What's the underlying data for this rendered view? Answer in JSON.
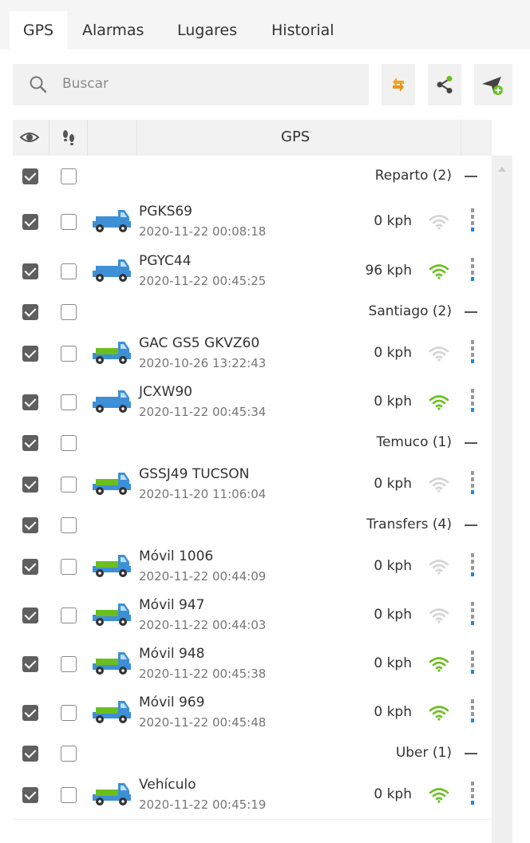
{
  "tabs": [
    {
      "label": "GPS",
      "active": true
    },
    {
      "label": "Alarmas",
      "active": false
    },
    {
      "label": "Lugares",
      "active": false
    },
    {
      "label": "Historial",
      "active": false
    }
  ],
  "search": {
    "placeholder": "Buscar",
    "icon": "search-icon"
  },
  "toolbar": [
    {
      "name": "refresh-button",
      "icon": "sync-icon",
      "color": "#f5a623"
    },
    {
      "name": "share-button",
      "icon": "share-icon",
      "color": "#6abf1e"
    },
    {
      "name": "add-device-button",
      "icon": "send-add-icon",
      "color": "#6abf1e"
    }
  ],
  "header": {
    "visibility_icon": "eye-icon",
    "follow_icon": "footprints-icon",
    "title": "GPS"
  },
  "colors": {
    "accent_green": "#6abf1e",
    "checkbox_dark": "#5f5f5f",
    "menu_blue": "#1e88e5",
    "truck_blue": "#3d8fd6"
  },
  "groups": [
    {
      "label": "Reparto (2)",
      "visible": true,
      "follow": false,
      "vehicles": [
        {
          "name": "PGKS69",
          "time": "2020-11-22 00:08:18",
          "speed": "0 kph",
          "online": false,
          "cargo": "blue",
          "visible": true,
          "follow": false
        },
        {
          "name": "PGYC44",
          "time": "2020-11-22 00:45:25",
          "speed": "96 kph",
          "online": true,
          "cargo": "blue",
          "visible": true,
          "follow": false
        }
      ]
    },
    {
      "label": "Santiago (2)",
      "visible": true,
      "follow": false,
      "vehicles": [
        {
          "name": "GAC GS5 GKVZ60",
          "time": "2020-10-26 13:22:43",
          "speed": "0 kph",
          "online": false,
          "cargo": "green",
          "visible": true,
          "follow": false
        },
        {
          "name": "JCXW90",
          "time": "2020-11-22 00:45:34",
          "speed": "0 kph",
          "online": true,
          "cargo": "blue",
          "visible": true,
          "follow": false
        }
      ]
    },
    {
      "label": "Temuco (1)",
      "visible": true,
      "follow": false,
      "vehicles": [
        {
          "name": "GSSJ49 TUCSON",
          "time": "2020-11-20 11:06:04",
          "speed": "0 kph",
          "online": false,
          "cargo": "green",
          "visible": true,
          "follow": false
        }
      ]
    },
    {
      "label": "Transfers (4)",
      "visible": true,
      "follow": false,
      "vehicles": [
        {
          "name": "Móvil 1006",
          "time": "2020-11-22 00:44:09",
          "speed": "0 kph",
          "online": false,
          "cargo": "green",
          "visible": true,
          "follow": false
        },
        {
          "name": "Móvil 947",
          "time": "2020-11-22 00:44:03",
          "speed": "0 kph",
          "online": false,
          "cargo": "green",
          "visible": true,
          "follow": false
        },
        {
          "name": "Móvil 948",
          "time": "2020-11-22 00:45:38",
          "speed": "0 kph",
          "online": true,
          "cargo": "green",
          "visible": true,
          "follow": false
        },
        {
          "name": "Móvil 969",
          "time": "2020-11-22 00:45:48",
          "speed": "0 kph",
          "online": true,
          "cargo": "green",
          "visible": true,
          "follow": false
        }
      ]
    },
    {
      "label": "Uber (1)",
      "visible": true,
      "follow": false,
      "vehicles": [
        {
          "name": "Vehículo",
          "time": "2020-11-22 00:45:19",
          "speed": "0 kph",
          "online": true,
          "cargo": "green",
          "visible": true,
          "follow": false
        }
      ]
    }
  ]
}
